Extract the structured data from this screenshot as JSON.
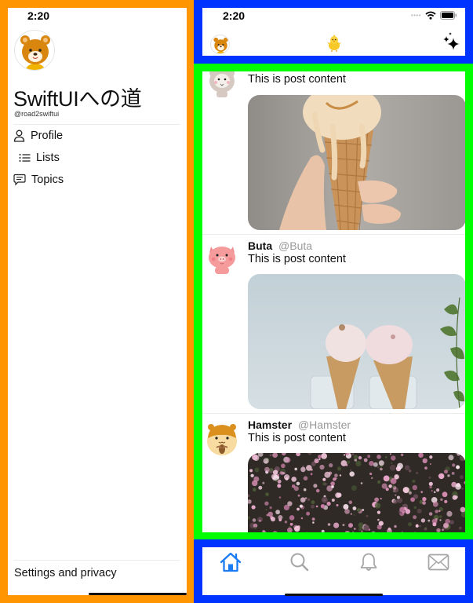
{
  "status_bar": {
    "time": "2:20"
  },
  "drawer": {
    "title": "SwiftUIへの道",
    "handle": "@road2swiftui",
    "menu": [
      {
        "label": "Profile",
        "icon": "person-icon"
      },
      {
        "label": "Lists",
        "icon": "list-icon"
      },
      {
        "label": "Topics",
        "icon": "message-icon"
      }
    ],
    "settings_label": "Settings and privacy"
  },
  "top_nav": {
    "avatar": "bear-avatar",
    "logo": "chick-logo",
    "action_icon": "sparkles-icon"
  },
  "feed": {
    "posts": [
      {
        "name": "",
        "handle": "",
        "text": "This is post content",
        "avatar": "alpaca-avatar",
        "image": "ice-cream-cone-in-hand"
      },
      {
        "name": "Buta",
        "handle": "@Buta",
        "text": "This is post content",
        "avatar": "pig-avatar",
        "image": "two-ice-cream-cones-in-jars"
      },
      {
        "name": "Hamster",
        "handle": "@Hamster",
        "text": "This is post content",
        "avatar": "hamster-avatar",
        "image": "pink-blossoms"
      }
    ]
  },
  "tab_bar": {
    "tabs": [
      {
        "name": "home",
        "active": true
      },
      {
        "name": "search",
        "active": false
      },
      {
        "name": "notifications",
        "active": false
      },
      {
        "name": "messages",
        "active": false
      }
    ],
    "active_color": "#1a7cf5",
    "inactive_color": "#a5a5a5"
  },
  "colors": {
    "outline_drawer": "#ff9500",
    "outline_nav": "#0033ff",
    "outline_feed": "#00ff00"
  }
}
